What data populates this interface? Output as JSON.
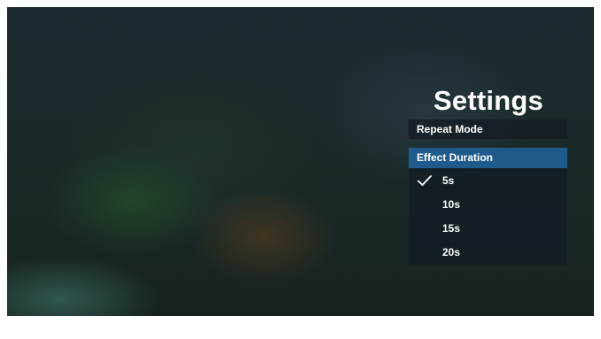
{
  "settings": {
    "title": "Settings",
    "repeat_mode_label": "Repeat Mode",
    "effect_duration_label": "Effect Duration",
    "options": [
      "5s",
      "10s",
      "15s",
      "20s"
    ],
    "selected_option": "5s"
  },
  "icons": {
    "selected_indicator": "checkmark-icon"
  },
  "colors": {
    "highlight": "#1e5b8c"
  }
}
